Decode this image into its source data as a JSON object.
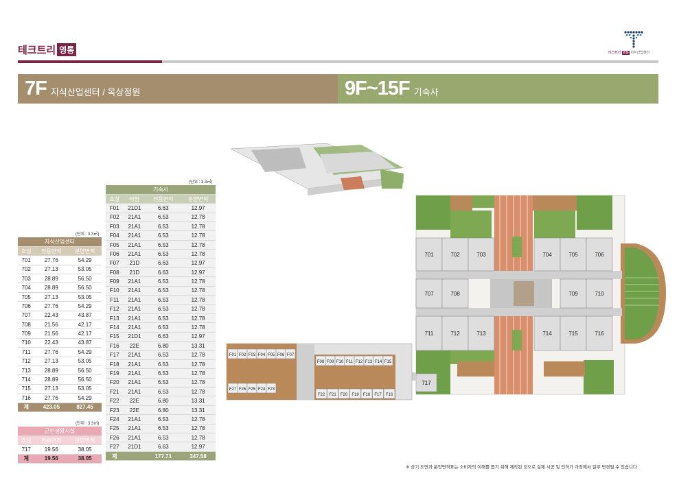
{
  "header": {
    "brand": "테크트리",
    "brand_tag": "영통",
    "logo_label_left": "테크트리",
    "logo_label_tag": "영통",
    "logo_label_right": "지식산업센터"
  },
  "banners": {
    "left_big": "7F",
    "left_small": "지식산업센터 / 옥상정원",
    "right_big": "9F~15F",
    "right_small": "기숙사"
  },
  "colors": {
    "brand": "#7a2244",
    "tan": "#a48e6e",
    "sage": "#98a86f",
    "pink": "#e8a9b4"
  },
  "table_knowledge": {
    "unit": "(단위 : 3.3㎡)",
    "title": "지식산업센터",
    "headers": [
      "호실",
      "전용면적",
      "분양면적"
    ],
    "rows": [
      [
        "701",
        "27.76",
        "54.29"
      ],
      [
        "702",
        "27.13",
        "53.05"
      ],
      [
        "703",
        "28.89",
        "56.50"
      ],
      [
        "704",
        "28.89",
        "56.50"
      ],
      [
        "705",
        "27.13",
        "53.05"
      ],
      [
        "706",
        "27.76",
        "54.29"
      ],
      [
        "707",
        "22.43",
        "43.87"
      ],
      [
        "708",
        "21.56",
        "42.17"
      ],
      [
        "709",
        "21.56",
        "42.17"
      ],
      [
        "710",
        "22.43",
        "43.87"
      ],
      [
        "711",
        "27.76",
        "54.29"
      ],
      [
        "712",
        "27.13",
        "53.05"
      ],
      [
        "713",
        "28.89",
        "56.50"
      ],
      [
        "714",
        "28.89",
        "56.50"
      ],
      [
        "715",
        "27.13",
        "53.05"
      ],
      [
        "716",
        "27.76",
        "54.29"
      ]
    ],
    "total": [
      "계",
      "423.05",
      "827.45"
    ]
  },
  "table_dorm": {
    "unit": "(단위 : 3.3㎡)",
    "title": "기숙사",
    "headers": [
      "호실",
      "타입",
      "전용면적",
      "분양면적"
    ],
    "rows": [
      [
        "F01",
        "21D1",
        "6.63",
        "12.97"
      ],
      [
        "F02",
        "21A1",
        "6.53",
        "12.78"
      ],
      [
        "F03",
        "21A1",
        "6.53",
        "12.78"
      ],
      [
        "F04",
        "21A1",
        "6.53",
        "12.78"
      ],
      [
        "F05",
        "21A1",
        "6.53",
        "12.78"
      ],
      [
        "F06",
        "21A1",
        "6.53",
        "12.78"
      ],
      [
        "F07",
        "21D",
        "6.63",
        "12.97"
      ],
      [
        "F08",
        "21D",
        "6.63",
        "12.97"
      ],
      [
        "F09",
        "21A1",
        "6.53",
        "12.78"
      ],
      [
        "F10",
        "21A1",
        "6.53",
        "12.78"
      ],
      [
        "F11",
        "21A1",
        "6.53",
        "12.78"
      ],
      [
        "F12",
        "21A1",
        "6.53",
        "12.78"
      ],
      [
        "F13",
        "21A1",
        "6.53",
        "12.78"
      ],
      [
        "F14",
        "21A1",
        "6.53",
        "12.78"
      ],
      [
        "F15",
        "21D1",
        "6.63",
        "12.97"
      ],
      [
        "F16",
        "22E",
        "6.80",
        "13.31"
      ],
      [
        "F17",
        "21A1",
        "6.53",
        "12.78"
      ],
      [
        "F18",
        "21A1",
        "6.53",
        "12.78"
      ],
      [
        "F19",
        "21A1",
        "6.53",
        "12.78"
      ],
      [
        "F20",
        "21A1",
        "6.53",
        "12.78"
      ],
      [
        "F21",
        "21A1",
        "6.53",
        "12.78"
      ],
      [
        "F22",
        "22E",
        "6.80",
        "13.31"
      ],
      [
        "F23",
        "22E",
        "6.80",
        "13.31"
      ],
      [
        "F24",
        "21A1",
        "6.53",
        "12.78"
      ],
      [
        "F25",
        "21A1",
        "6.53",
        "12.78"
      ],
      [
        "F26",
        "21A1",
        "6.53",
        "12.78"
      ],
      [
        "F27",
        "21D1",
        "6.63",
        "12.97"
      ]
    ],
    "total": [
      "계",
      "",
      "177.71",
      "347.58"
    ]
  },
  "table_retail": {
    "unit": "(단위 : 3.3㎡)",
    "title": "근린생활시설",
    "headers": [
      "호실",
      "전용면적",
      "분양면적"
    ],
    "rows": [
      [
        "717",
        "19.56",
        "38.05"
      ]
    ],
    "total": [
      "계",
      "19.56",
      "38.05"
    ]
  },
  "plan": {
    "office_top": [
      "701",
      "702",
      "703",
      "704",
      "705",
      "706"
    ],
    "office_mid": [
      "707",
      "708",
      "709",
      "710"
    ],
    "office_bot": [
      "711",
      "712",
      "713",
      "714",
      "715",
      "716"
    ],
    "retail": "717",
    "dorm_left_top": [
      "F01",
      "F02",
      "F03",
      "F04",
      "F05",
      "F06",
      "F07"
    ],
    "dorm_left_bot": [
      "F27",
      "F26",
      "F25",
      "F24",
      "F23"
    ],
    "dorm_right_top": [
      "F08",
      "F09",
      "F10",
      "F11",
      "F12",
      "F13",
      "F14",
      "F15"
    ],
    "dorm_right_bot": [
      "F22",
      "F21",
      "F20",
      "F19",
      "F18",
      "F17",
      "F16"
    ]
  },
  "footnote": "※ 상기 도면과 분양면적표는 소비자의 이해를 돕기 위해 제작된 것으로 실제 시공 및 인허가 과정에서 일부 변경될 수 있습니다."
}
